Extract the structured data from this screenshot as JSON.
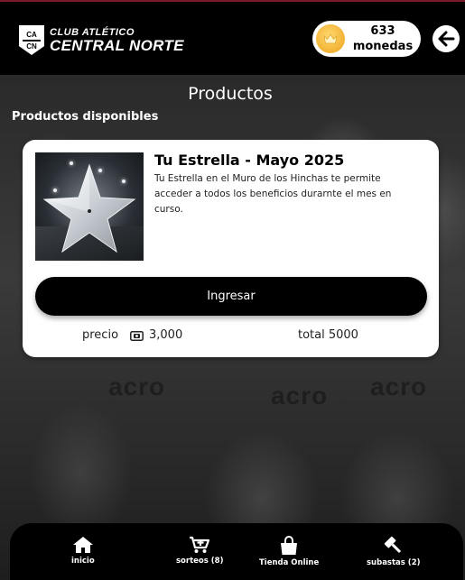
{
  "header": {
    "club_line1": "CLUB ATLÉTICO",
    "club_line2": "CENTRAL NORTE",
    "crest_top": "CA",
    "crest_bottom": "CN",
    "coins": {
      "amount": "633",
      "label": "monedas",
      "icon": "crown-coin-icon"
    },
    "back_icon": "arrow-left-icon"
  },
  "page": {
    "title": "Productos",
    "section_title": "Productos disponibles"
  },
  "product": {
    "title": "Tu Estrella - Mayo 2025",
    "description": "Tu Estrella en el Muro de los Hinchas te permite acceder a todos los beneficios durarnte el mes en curso.",
    "image_icon": "silver-star-image",
    "button_label": "Ingresar",
    "price_label": "precio",
    "price_icon": "ticket-icon",
    "price_value": "3,000",
    "total_label": "total 5000"
  },
  "bottom_nav": {
    "items": [
      {
        "label": "inicio",
        "icon": "home-icon"
      },
      {
        "label": "sorteos (8)",
        "icon": "cart-plus-icon"
      },
      {
        "label": "Tienda Online",
        "icon": "shopping-bag-icon"
      },
      {
        "label": "subastas (2)",
        "icon": "gavel-icon"
      }
    ]
  },
  "colors": {
    "header_bg": "#000000",
    "coin_gold": "#f2b233",
    "card_bg": "#ffffff",
    "button_bg": "#000000"
  }
}
